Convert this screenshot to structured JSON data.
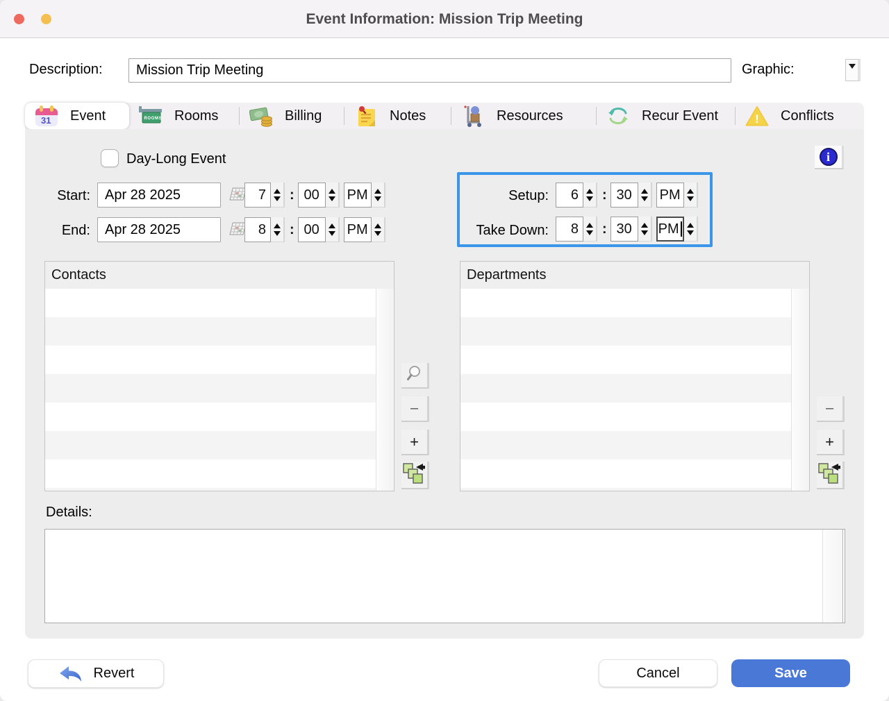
{
  "window": {
    "title": "Event Information: Mission Trip Meeting"
  },
  "header": {
    "description_label": "Description:",
    "description_value": "Mission Trip Meeting",
    "graphic_label": "Graphic:"
  },
  "tabs": [
    {
      "label": "Event",
      "icon": "calendar-31-icon",
      "selected": true
    },
    {
      "label": "Rooms",
      "icon": "rooms-sign-icon",
      "selected": false
    },
    {
      "label": "Billing",
      "icon": "money-coins-icon",
      "selected": false
    },
    {
      "label": "Notes",
      "icon": "sticky-note-icon",
      "selected": false
    },
    {
      "label": "Resources",
      "icon": "hand-truck-icon",
      "selected": false
    },
    {
      "label": "Recur Event",
      "icon": "recur-arrows-icon",
      "selected": false
    },
    {
      "label": "Conflicts",
      "icon": "warning-triangle-icon",
      "selected": false
    }
  ],
  "event": {
    "day_long_label": "Day-Long Event",
    "day_long_checked": false,
    "time_separator": ":",
    "start": {
      "label": "Start:",
      "date": "Apr 28 2025",
      "hour": "7",
      "minute": "00",
      "period": "PM"
    },
    "end": {
      "label": "End:",
      "date": "Apr 28 2025",
      "hour": "8",
      "minute": "00",
      "period": "PM"
    },
    "setup": {
      "label": "Setup:",
      "hour": "6",
      "minute": "30",
      "period": "PM"
    },
    "take_down": {
      "label": "Take Down:",
      "hour": "8",
      "minute": "30",
      "period": "PM"
    },
    "contacts_header": "Contacts",
    "contacts_rows": [],
    "departments_header": "Departments",
    "departments_rows": [],
    "details_label": "Details:",
    "details_value": ""
  },
  "buttons": {
    "remove": "–",
    "add": "+"
  },
  "footer": {
    "revert": "Revert",
    "cancel": "Cancel",
    "save": "Save"
  },
  "colors": {
    "highlight": "#3b96ea",
    "save_bg": "#4a78d7",
    "traffic_red": "#ee6a5f",
    "traffic_yellow": "#f5bf4f"
  }
}
